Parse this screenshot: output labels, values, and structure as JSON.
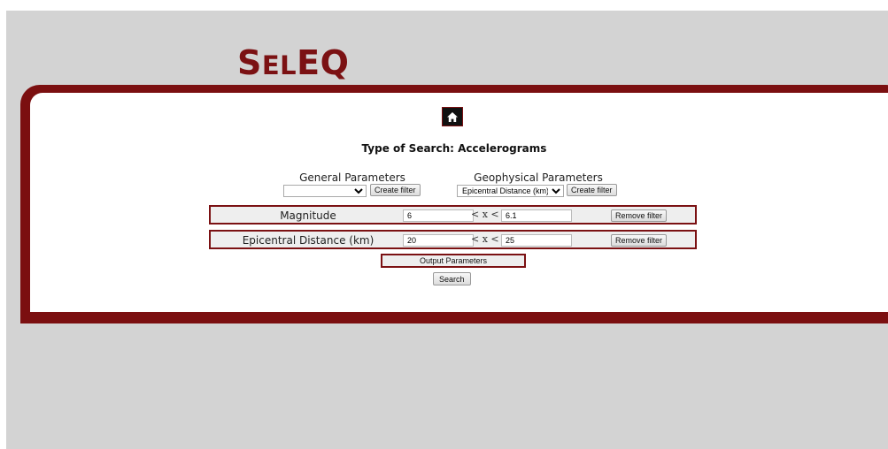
{
  "app": {
    "logo_big1": "S",
    "logo_small1": "EL",
    "logo_big2": "EQ"
  },
  "header": {
    "title": "Type of Search: Accelerograms"
  },
  "general": {
    "heading": "General Parameters",
    "selected": "",
    "create_label": "Create filter"
  },
  "geophysical": {
    "heading": "Geophysical Parameters",
    "selected": "Epicentral Distance (km)",
    "create_label": "Create filter"
  },
  "filters": [
    {
      "label": "Magnitude",
      "min": "6",
      "operator": "< x <",
      "max": "6.1",
      "remove_label": "Remove filter"
    },
    {
      "label": "Epicentral Distance (km)",
      "min": "20",
      "operator": "< x <",
      "max": "25",
      "remove_label": "Remove filter"
    }
  ],
  "output_params_label": "Output Parameters",
  "search_label": "Search",
  "colors": {
    "brand": "#7b1113",
    "page_bg": "#d3d3d3"
  },
  "icons": {
    "home": "home-icon",
    "dropdown": "chevron-down-icon"
  }
}
